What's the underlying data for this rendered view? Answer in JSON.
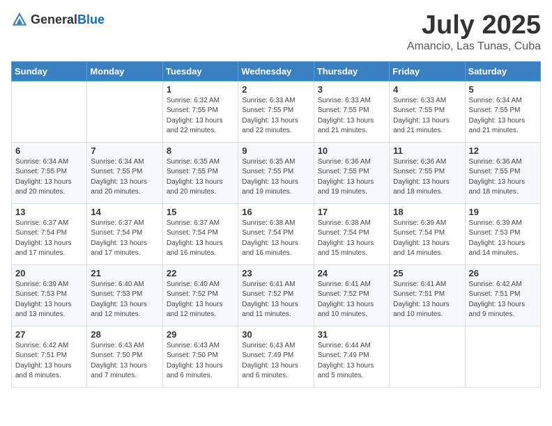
{
  "header": {
    "logo_general": "General",
    "logo_blue": "Blue",
    "month": "July 2025",
    "location": "Amancio, Las Tunas, Cuba"
  },
  "weekdays": [
    "Sunday",
    "Monday",
    "Tuesday",
    "Wednesday",
    "Thursday",
    "Friday",
    "Saturday"
  ],
  "weeks": [
    [
      {
        "day": "",
        "info": ""
      },
      {
        "day": "",
        "info": ""
      },
      {
        "day": "1",
        "info": "Sunrise: 6:32 AM\nSunset: 7:55 PM\nDaylight: 13 hours and 22 minutes."
      },
      {
        "day": "2",
        "info": "Sunrise: 6:33 AM\nSunset: 7:55 PM\nDaylight: 13 hours and 22 minutes."
      },
      {
        "day": "3",
        "info": "Sunrise: 6:33 AM\nSunset: 7:55 PM\nDaylight: 13 hours and 21 minutes."
      },
      {
        "day": "4",
        "info": "Sunrise: 6:33 AM\nSunset: 7:55 PM\nDaylight: 13 hours and 21 minutes."
      },
      {
        "day": "5",
        "info": "Sunrise: 6:34 AM\nSunset: 7:55 PM\nDaylight: 13 hours and 21 minutes."
      }
    ],
    [
      {
        "day": "6",
        "info": "Sunrise: 6:34 AM\nSunset: 7:55 PM\nDaylight: 13 hours and 20 minutes."
      },
      {
        "day": "7",
        "info": "Sunrise: 6:34 AM\nSunset: 7:55 PM\nDaylight: 13 hours and 20 minutes."
      },
      {
        "day": "8",
        "info": "Sunrise: 6:35 AM\nSunset: 7:55 PM\nDaylight: 13 hours and 20 minutes."
      },
      {
        "day": "9",
        "info": "Sunrise: 6:35 AM\nSunset: 7:55 PM\nDaylight: 13 hours and 19 minutes."
      },
      {
        "day": "10",
        "info": "Sunrise: 6:36 AM\nSunset: 7:55 PM\nDaylight: 13 hours and 19 minutes."
      },
      {
        "day": "11",
        "info": "Sunrise: 6:36 AM\nSunset: 7:55 PM\nDaylight: 13 hours and 18 minutes."
      },
      {
        "day": "12",
        "info": "Sunrise: 6:36 AM\nSunset: 7:55 PM\nDaylight: 13 hours and 18 minutes."
      }
    ],
    [
      {
        "day": "13",
        "info": "Sunrise: 6:37 AM\nSunset: 7:54 PM\nDaylight: 13 hours and 17 minutes."
      },
      {
        "day": "14",
        "info": "Sunrise: 6:37 AM\nSunset: 7:54 PM\nDaylight: 13 hours and 17 minutes."
      },
      {
        "day": "15",
        "info": "Sunrise: 6:37 AM\nSunset: 7:54 PM\nDaylight: 13 hours and 16 minutes."
      },
      {
        "day": "16",
        "info": "Sunrise: 6:38 AM\nSunset: 7:54 PM\nDaylight: 13 hours and 16 minutes."
      },
      {
        "day": "17",
        "info": "Sunrise: 6:38 AM\nSunset: 7:54 PM\nDaylight: 13 hours and 15 minutes."
      },
      {
        "day": "18",
        "info": "Sunrise: 6:39 AM\nSunset: 7:54 PM\nDaylight: 13 hours and 14 minutes."
      },
      {
        "day": "19",
        "info": "Sunrise: 6:39 AM\nSunset: 7:53 PM\nDaylight: 13 hours and 14 minutes."
      }
    ],
    [
      {
        "day": "20",
        "info": "Sunrise: 6:39 AM\nSunset: 7:53 PM\nDaylight: 13 hours and 13 minutes."
      },
      {
        "day": "21",
        "info": "Sunrise: 6:40 AM\nSunset: 7:53 PM\nDaylight: 13 hours and 12 minutes."
      },
      {
        "day": "22",
        "info": "Sunrise: 6:40 AM\nSunset: 7:52 PM\nDaylight: 13 hours and 12 minutes."
      },
      {
        "day": "23",
        "info": "Sunrise: 6:41 AM\nSunset: 7:52 PM\nDaylight: 13 hours and 11 minutes."
      },
      {
        "day": "24",
        "info": "Sunrise: 6:41 AM\nSunset: 7:52 PM\nDaylight: 13 hours and 10 minutes."
      },
      {
        "day": "25",
        "info": "Sunrise: 6:41 AM\nSunset: 7:51 PM\nDaylight: 13 hours and 10 minutes."
      },
      {
        "day": "26",
        "info": "Sunrise: 6:42 AM\nSunset: 7:51 PM\nDaylight: 13 hours and 9 minutes."
      }
    ],
    [
      {
        "day": "27",
        "info": "Sunrise: 6:42 AM\nSunset: 7:51 PM\nDaylight: 13 hours and 8 minutes."
      },
      {
        "day": "28",
        "info": "Sunrise: 6:43 AM\nSunset: 7:50 PM\nDaylight: 13 hours and 7 minutes."
      },
      {
        "day": "29",
        "info": "Sunrise: 6:43 AM\nSunset: 7:50 PM\nDaylight: 13 hours and 6 minutes."
      },
      {
        "day": "30",
        "info": "Sunrise: 6:43 AM\nSunset: 7:49 PM\nDaylight: 13 hours and 6 minutes."
      },
      {
        "day": "31",
        "info": "Sunrise: 6:44 AM\nSunset: 7:49 PM\nDaylight: 13 hours and 5 minutes."
      },
      {
        "day": "",
        "info": ""
      },
      {
        "day": "",
        "info": ""
      }
    ]
  ]
}
